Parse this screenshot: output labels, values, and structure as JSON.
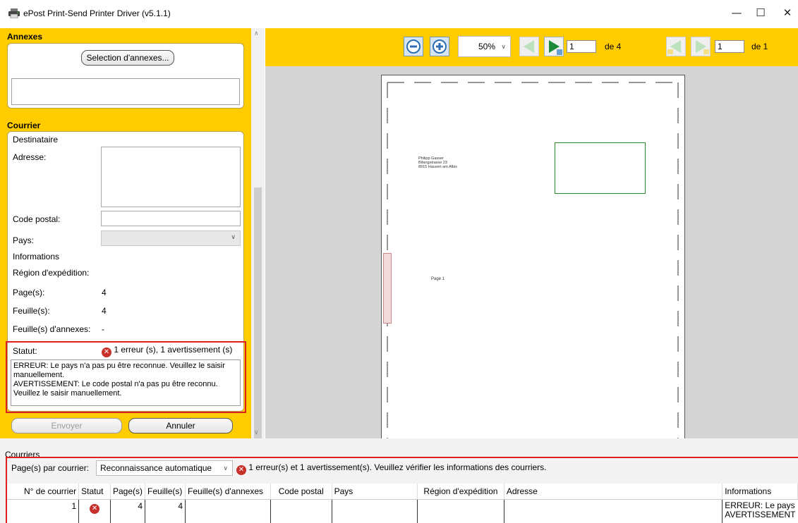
{
  "window": {
    "title": "ePost Print-Send Printer Driver (v5.1.1)",
    "minimize_glyph": "—",
    "maximize_glyph": "☐",
    "close_glyph": "✕"
  },
  "annexes": {
    "header": "Annexes",
    "select_button": "Selection d'annexes..."
  },
  "courrier": {
    "header": "Courrier",
    "destinataire_label": "Destinataire",
    "adresse_label": "Adresse:",
    "code_postal_label": "Code postal:",
    "pays_label": "Pays:",
    "informations_label": "Informations",
    "region_label": "Région d'expédition:",
    "pages_label": "Page(s):",
    "pages_value": "4",
    "feuilles_label": "Feuille(s):",
    "feuilles_value": "4",
    "feuilles_annexes_label": "Feuille(s) d'annexes:",
    "feuilles_annexes_value": "-",
    "statut_label": "Statut:",
    "statut_value": "1 erreur (s), 1 avertissement (s)",
    "status_message": "ERREUR: Le pays n'a pas pu être reconnue. Veuillez le saisir manuellement.\nAVERTISSEMENT: Le code postal n'a pas pu être reconnu. Veuillez le saisir manuellement."
  },
  "actions": {
    "send": "Envoyer",
    "cancel": "Annuler"
  },
  "toolbar": {
    "zoom_value": "50%",
    "page_value": "1",
    "page_total_label": "de 4",
    "annex_page_value": "1",
    "annex_total_label": "de 1"
  },
  "preview": {
    "address_lines": [
      "Philipp Gasser",
      "Bifangstrasse 23",
      "8915 Hausen am Albis"
    ],
    "page_label": "Page 1"
  },
  "bottom": {
    "section_title": "Courriers",
    "pages_par_courrier_label": "Page(s) par courrier:",
    "mode_value": "Reconnaissance automatique",
    "summary": "1 erreur(s) et 1 avertissement(s). Veuillez vérifier les informations des courriers.",
    "columns": [
      "N° de courrier",
      "Statut",
      "Page(s)",
      "Feuille(s)",
      "Feuille(s) d'annexes",
      "Code postal",
      "Pays",
      "Région d'expédition",
      "Adresse",
      "Informations"
    ],
    "row": {
      "numero": "1",
      "pages": "4",
      "feuilles": "4",
      "info_line1": "ERREUR: Le pays",
      "info_line2": "AVERTISSEMENT"
    }
  },
  "colors": {
    "accent_yellow": "#ffcc00",
    "error_red": "#c8302a",
    "frame_red": "#e02020",
    "nav_green": "#1b8a3a"
  }
}
